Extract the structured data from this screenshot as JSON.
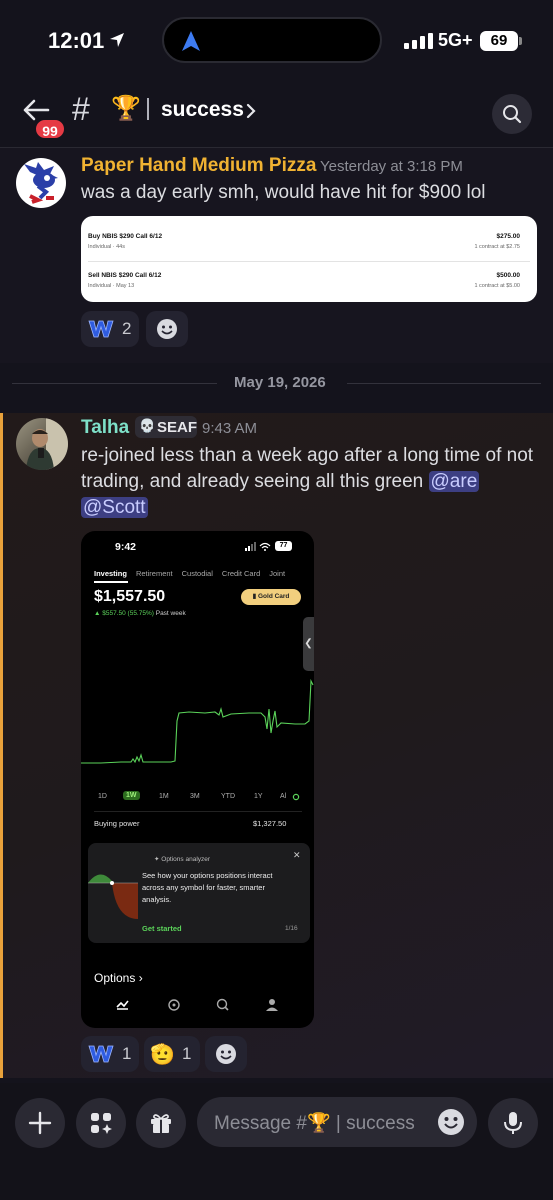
{
  "status_bar": {
    "time": "12:01",
    "network": "5G+",
    "battery": "69"
  },
  "header": {
    "unread_badge": "99",
    "hash": "#",
    "channel_emoji": "🏆",
    "channel_name": "success"
  },
  "messages": [
    {
      "author": "Paper Hand Medium Pizza",
      "timestamp": "Yesterday at 3:18 PM",
      "text": "was a day early smh, would have hit for $900 lol",
      "trades": [
        {
          "title": "Buy NBIS $290 Call 6/12",
          "sub": "Individual · 44s",
          "amount": "$275.00",
          "detail": "1 contract at $2.75"
        },
        {
          "title": "Sell NBIS $290 Call 6/12",
          "sub": "Individual · May 13",
          "amount": "$500.00",
          "detail": "1 contract at $5.00"
        }
      ],
      "reactions": [
        {
          "emoji": "W",
          "count": "2"
        }
      ]
    },
    {
      "author": "Talha",
      "tag": "SEAF",
      "timestamp": "9:43 AM",
      "text": "re-joined less than a week ago after a long time of not trading, and already seeing all this green ",
      "mentions": [
        "@are",
        "@Scott"
      ],
      "reactions": [
        {
          "emoji": "W",
          "count": "1"
        },
        {
          "emoji": "🫡",
          "count": "1"
        }
      ]
    }
  ],
  "date_divider": "May 19, 2026",
  "screenshot": {
    "time": "9:42",
    "battery": "77",
    "tabs": [
      "Investing",
      "Retirement",
      "Custodial",
      "Credit Card",
      "Joint"
    ],
    "balance": "$1,557.50",
    "gain": "▲ $557.50 (55.75%)",
    "gain_period": "Past week",
    "gold_card": "Gold Card",
    "ranges": [
      "1D",
      "1W",
      "1M",
      "3M",
      "YTD",
      "1Y",
      "Al"
    ],
    "selected_range": "1W",
    "buying_power_label": "Buying power",
    "buying_power_value": "$1,327.50",
    "card_title": "Options analyzer",
    "card_body": "See how your options positions interact across any symbol for faster, smarter analysis.",
    "card_cta": "Get started",
    "card_pager": "1/16",
    "options_label": "Options",
    "accent": "#5bd35a"
  },
  "composer": {
    "placeholder": "Message #🏆 | success"
  },
  "colors": {
    "pizza_name": "#f0b232",
    "talha_name": "#7ee0c8",
    "mention_bg": "#3d3f83",
    "highlight_bar": "#e9a23b"
  }
}
